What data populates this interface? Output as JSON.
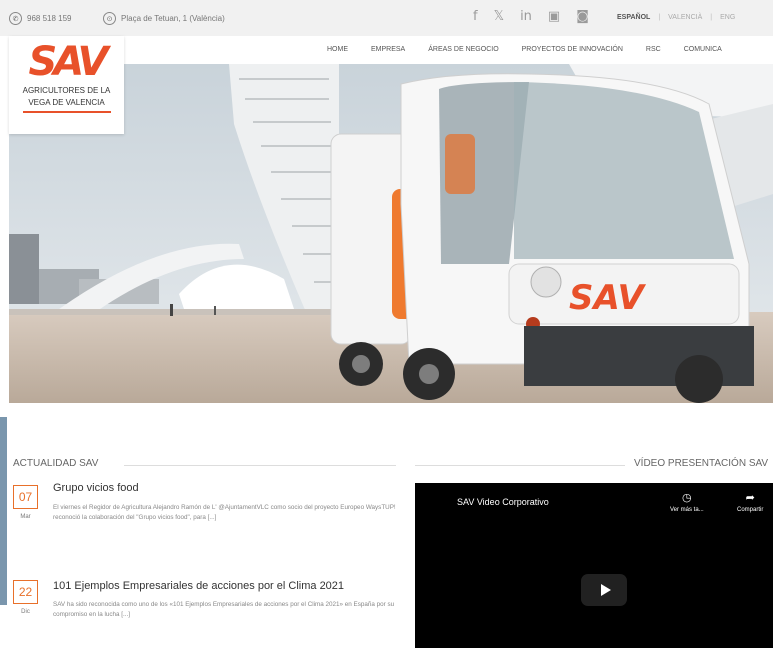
{
  "topbar": {
    "phone": "968 518 159",
    "address": "Plaça de Tetuan, 1 (València)",
    "social": [
      "f",
      "𝕏",
      "in",
      "▣",
      "◙"
    ],
    "languages": [
      {
        "label": "ESPAÑOL",
        "active": true
      },
      {
        "label": "VALENCIÀ",
        "active": false
      },
      {
        "label": "ENG",
        "active": false
      }
    ]
  },
  "logo": {
    "mark": "SAV",
    "line1": "AGRICULTORES DE LA",
    "line2": "VEGA DE VALENCIA"
  },
  "nav": [
    "HOME",
    "EMPRESA",
    "ÁREAS DE NEGOCIO",
    "PROYECTOS DE INNOVACIÓN",
    "RSC",
    "COMUNICA"
  ],
  "hero": {
    "vehicle_logo": "SAV"
  },
  "news": {
    "section_title": "ACTUALIDAD SAV",
    "items": [
      {
        "day": "07",
        "month": "Mar",
        "title": "Grupo vicios food",
        "text": "El viernes el Regidor de Agricultura Alejandro Ramón de L' @AjuntamentVLC como socio del proyecto Europeo WaysTUP! reconoció la colaboración del \"Grupo vicios food\", para [...]"
      },
      {
        "day": "22",
        "month": "Dic",
        "title": "101 Ejemplos Empresariales de acciones por el Clima 2021",
        "text": "SAV ha sido reconocida como uno de los «101 Ejemplos Empresariales de acciones por el Clima 2021» en España por su compromiso en la lucha [...]"
      }
    ]
  },
  "video": {
    "section_title": "VÍDEO PRESENTACIÓN SAV",
    "title": "SAV Video Corporativo",
    "watch_later": "Ver más ta...",
    "share": "Compartir"
  },
  "colors": {
    "accent": "#e8512a",
    "topbar_bg": "#f1f1f1",
    "video_bg": "#000000"
  }
}
